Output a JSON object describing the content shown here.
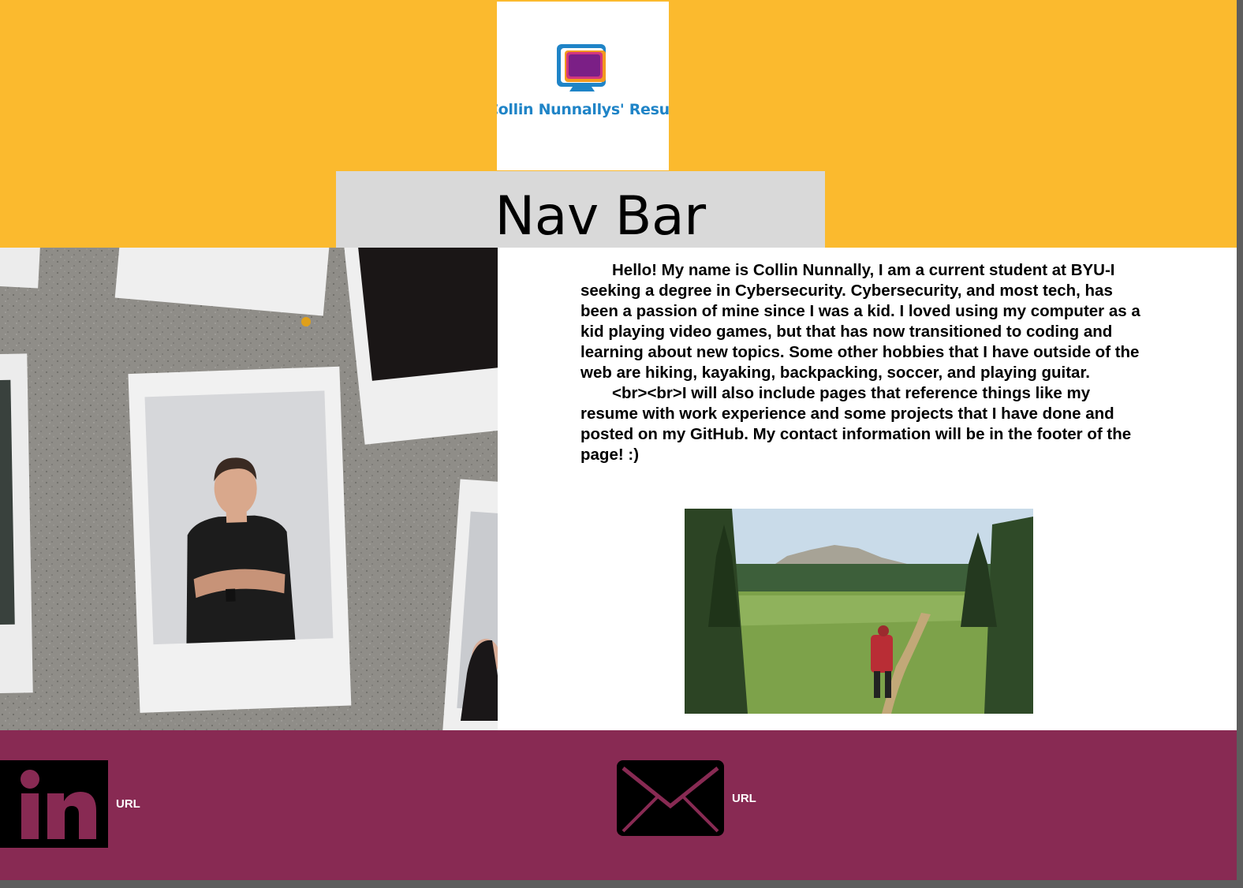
{
  "header": {
    "logo_text": "Collin Nunnallys' Resume",
    "nav_title": "Nav Bar"
  },
  "main": {
    "bio_paragraphs": [
      "Hello! My name is Collin Nunnally, I am a current student at BYU-I seeking a degree in Cybersecurity. Cybersecurity, and most tech, has been a passion of mine since I was a kid. I loved using my computer as a kid playing video games, but that has now transitioned to coding and learning about new topics. Some other hobbies that I have outside of the web are hiking, kayaking, backpacking, soccer, and playing guitar.",
      "<br><br>I will also include pages that reference things like my resume with work experience and some projects that I have done and posted on my GitHub. My contact information will be in the footer of the page! :)"
    ]
  },
  "footer": {
    "linkedin": {
      "icon": "linkedin-icon",
      "label": "URL"
    },
    "email": {
      "icon": "envelope-icon",
      "label": "URL"
    }
  },
  "colors": {
    "header_bg": "#fbba2e",
    "footer_bg": "#882a53",
    "nav_bg": "#d9d9d9",
    "logo_blue": "#1f84c7"
  }
}
